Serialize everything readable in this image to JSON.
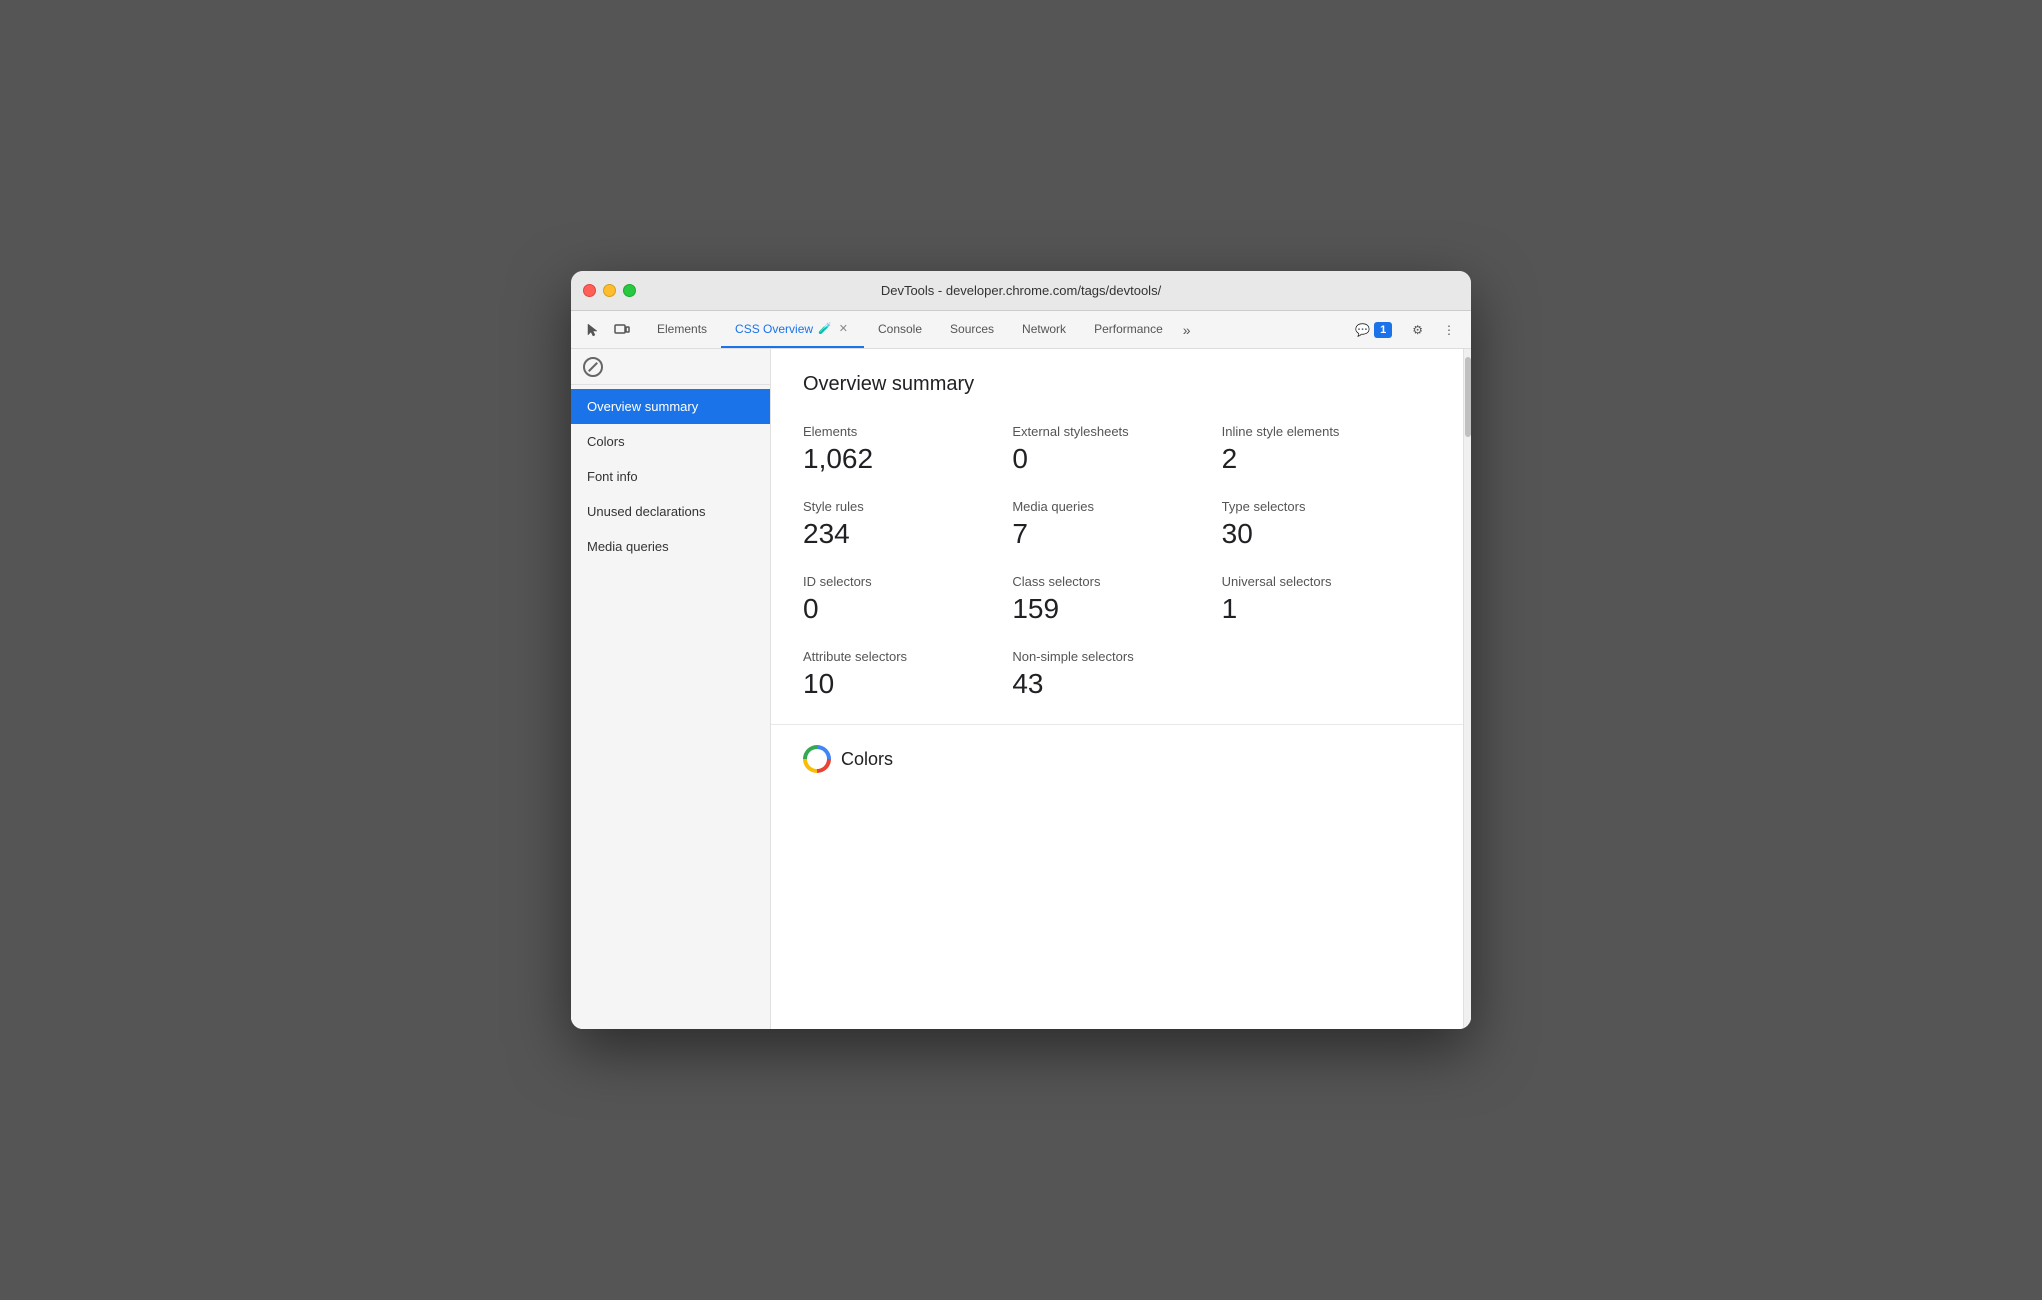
{
  "window": {
    "title": "DevTools - developer.chrome.com/tags/devtools/"
  },
  "toolbar": {
    "tabs": [
      {
        "id": "elements",
        "label": "Elements",
        "active": false,
        "closeable": false
      },
      {
        "id": "css-overview",
        "label": "CSS Overview",
        "active": true,
        "closeable": true,
        "experiment": true
      },
      {
        "id": "console",
        "label": "Console",
        "active": false,
        "closeable": false
      },
      {
        "id": "sources",
        "label": "Sources",
        "active": false,
        "closeable": false
      },
      {
        "id": "network",
        "label": "Network",
        "active": false,
        "closeable": false
      },
      {
        "id": "performance",
        "label": "Performance",
        "active": false,
        "closeable": false
      }
    ],
    "more_tabs_icon": "»",
    "notification_count": "1",
    "settings_tooltip": "Settings",
    "more_options_tooltip": "More options"
  },
  "sidebar": {
    "items": [
      {
        "id": "overview-summary",
        "label": "Overview summary",
        "active": true
      },
      {
        "id": "colors",
        "label": "Colors",
        "active": false
      },
      {
        "id": "font-info",
        "label": "Font info",
        "active": false
      },
      {
        "id": "unused-declarations",
        "label": "Unused declarations",
        "active": false
      },
      {
        "id": "media-queries",
        "label": "Media queries",
        "active": false
      }
    ]
  },
  "main": {
    "overview_title": "Overview summary",
    "stats": [
      {
        "label": "Elements",
        "value": "1,062"
      },
      {
        "label": "External stylesheets",
        "value": "0"
      },
      {
        "label": "Inline style elements",
        "value": "2"
      },
      {
        "label": "Style rules",
        "value": "234"
      },
      {
        "label": "Media queries",
        "value": "7"
      },
      {
        "label": "Type selectors",
        "value": "30"
      },
      {
        "label": "ID selectors",
        "value": "0"
      },
      {
        "label": "Class selectors",
        "value": "159"
      },
      {
        "label": "Universal selectors",
        "value": "1"
      },
      {
        "label": "Attribute selectors",
        "value": "10"
      },
      {
        "label": "Non-simple selectors",
        "value": "43"
      }
    ],
    "colors_section_label": "Colors"
  }
}
